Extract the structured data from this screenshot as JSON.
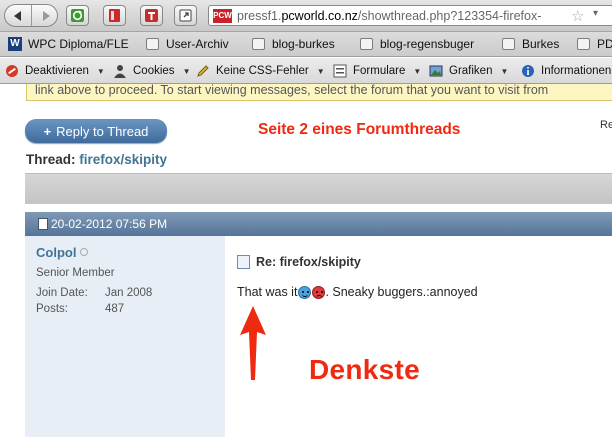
{
  "browser": {
    "address": {
      "favicon_text": "PCW",
      "url_prefix": "pressf1.",
      "url_domain": "pcworld.co.nz",
      "url_path": "/showthread.php?123354-firefox-"
    },
    "toolbar_icons": [
      "back-icon",
      "forward-icon",
      "reload-icon",
      "bookmark-icon",
      "tab-icon",
      "share-icon"
    ]
  },
  "bookmarks": {
    "items": [
      "WPC Diploma/FLE",
      "User-Archiv",
      "blog-burkes",
      "blog-regensbuger",
      "Burkes",
      "PD"
    ]
  },
  "devbar": {
    "items": [
      "Deaktivieren",
      "Cookies",
      "Keine CSS-Fehler",
      "Formulare",
      "Grafiken",
      "Informationen"
    ]
  },
  "page": {
    "notice": "link above to proceed. To start viewing messages, select the forum that you want to visit from",
    "reply_button": "Reply to Thread",
    "right_cutoff": "Re",
    "thread_label": "Thread:",
    "thread_name": "firefox/skipity",
    "post": {
      "date": "20-02-2012 07:56 PM",
      "username": "Colpol",
      "usertitle": "Senior Member",
      "join_label": "Join Date:",
      "join_value": "Jan 2008",
      "posts_label": "Posts:",
      "posts_value": "487",
      "title": "Re: firefox/skipity",
      "text_before": "That was it",
      "text_after": ". Sneaky buggers.:annoyed"
    }
  },
  "annotations": {
    "top": "Seite 2 eines Forumthreads",
    "big": "Denkste",
    "color": "#ef2a10"
  }
}
